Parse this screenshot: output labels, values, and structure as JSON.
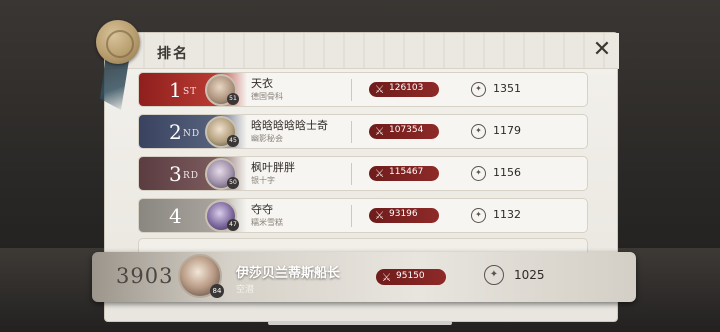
{
  "header": {
    "title": "排名"
  },
  "colors": {
    "rank1": "#a52a26",
    "rank2": "#4a5570",
    "rank3": "#6a4a4e",
    "rank4": "#8e8a84",
    "power_pill": "#7a2222"
  },
  "icons": {
    "close": "close-icon",
    "power": "crossed-swords-icon",
    "score": "compass-icon"
  },
  "leaderboard": [
    {
      "rank": "1",
      "suffix": "ST",
      "name": "天衣",
      "guild": "德国骨科",
      "level": "51",
      "power": "126103",
      "score": "1351"
    },
    {
      "rank": "2",
      "suffix": "ND",
      "name": "晗晗晗晗晗士奇",
      "guild": "幽影秘会",
      "level": "45",
      "power": "107354",
      "score": "1179"
    },
    {
      "rank": "3",
      "suffix": "RD",
      "name": "枫叶胖胖",
      "guild": "银十字",
      "level": "50",
      "power": "115467",
      "score": "1156"
    },
    {
      "rank": "4",
      "suffix": "",
      "name": "夺夺",
      "guild": "糯米雪糕",
      "level": "47",
      "power": "93196",
      "score": "1132"
    }
  ],
  "self": {
    "rank": "3903",
    "name": "伊莎贝兰蒂斯船长",
    "guild": "空潜",
    "level": "84",
    "power": "95150",
    "score": "1025"
  }
}
